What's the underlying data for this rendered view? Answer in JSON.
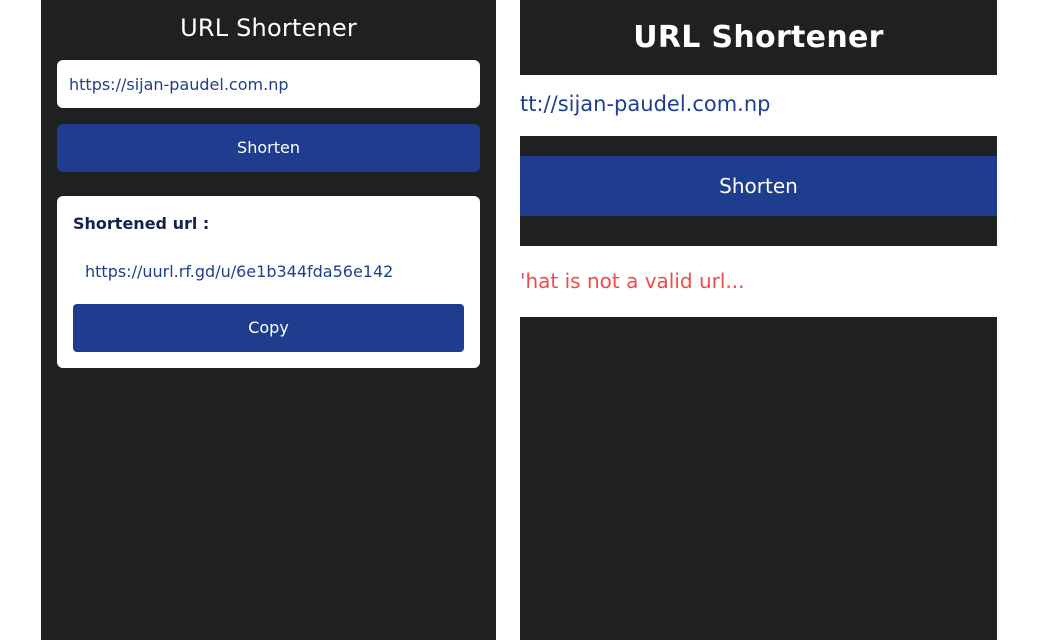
{
  "left_panel": {
    "title": "URL Shortener",
    "url_input_value": "https://sijan-paudel.com.np",
    "shorten_label": "Shorten",
    "result": {
      "label": "Shortened url :",
      "short_url": "https://uurl.rf.gd/u/6e1b344fda56e142",
      "copy_label": "Copy"
    }
  },
  "right_panel": {
    "title": "URL Shortener",
    "url_input_value": "tt://sijan-paudel.com.np",
    "shorten_label": "Shorten",
    "error_message": "'hat is not a valid url..."
  },
  "colors": {
    "panel_bg": "#1f2022",
    "button_blue": "#1f3d8f",
    "link_blue": "#1e3f8f",
    "error_red": "#ef4b4b"
  }
}
